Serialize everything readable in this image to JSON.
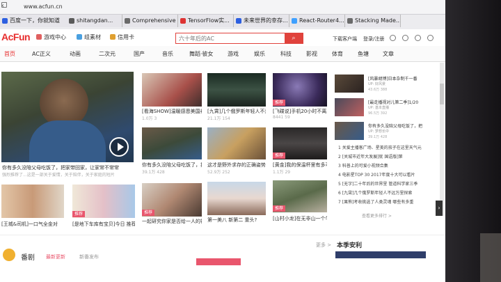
{
  "browser": {
    "url": "www.acfun.cn",
    "tabs": [
      {
        "label": "百度一下，你就知道",
        "color": "#2d5fe0"
      },
      {
        "label": "shitangdan...",
        "color": "#5a5a5a"
      },
      {
        "label": "Comprehensive",
        "color": "#6a6a6a"
      },
      {
        "label": "TensorFlow实...",
        "color": "#d33"
      },
      {
        "label": "未来世界的幸存...",
        "color": "#2d5fe0"
      },
      {
        "label": "React-Router4...",
        "color": "#3fa0ff"
      },
      {
        "label": "Stacking Made...",
        "color": "#6a6a6a"
      }
    ]
  },
  "header": {
    "logo": "AcFun",
    "links": [
      "游戏中心",
      "组素材",
      "信用卡"
    ],
    "search_placeholder": "六十年后的AC",
    "download_client": "下载客户端",
    "login": "登录/注册"
  },
  "categories": [
    "首页",
    "AC正义",
    "动画",
    "二次元",
    "国产",
    "音乐",
    "舞蹈·彼女",
    "游戏",
    "娱乐",
    "科技",
    "影视",
    "体育",
    "鱼塘",
    "文章"
  ],
  "feature": {
    "caption": "你有多久没陪父母吃饭了，把家带回家，让家常不常常",
    "caption2": "强烈推荐了...这是一部关于爱情，关于陪伴，关于家庭的短片"
  },
  "grid": [
    {
      "title": "[看海SHOW]温暖感恩美国养",
      "meta": "1.0万  3",
      "badge": ""
    },
    {
      "title": "[九霄]几个俄罗斯年轻人不远",
      "meta": "21.1万  154",
      "badge": ""
    },
    {
      "title": "[飞碟说]手机20小时不离身...",
      "meta": "8441  59",
      "badge": "推荐"
    },
    {
      "title": "你有多久没陪父母吃饭了，把",
      "meta": "39.1万  428",
      "badge": ""
    },
    {
      "title": "这才是野外求存的正确姿势，看",
      "meta": "52.9万  252",
      "badge": ""
    },
    {
      "title": "[黄金]我的保温杯里有多可",
      "meta": "1.1万  29",
      "badge": "推荐"
    },
    {
      "title": "[王城&司机]一口气全金对",
      "meta": "",
      "badge": ""
    },
    {
      "title": "[是地下车库有宝贝]今日 推荐",
      "meta": "",
      "badge": "推荐"
    },
    {
      "title": "一起研究你家是否给一人的符",
      "meta": "",
      "badge": "推荐"
    },
    {
      "title": "第一美八 新第二 重头?",
      "meta": "",
      "badge": ""
    },
    {
      "title": "[山村小龙]在无非山一个牛不",
      "meta": "",
      "badge": "推荐"
    }
  ],
  "ranking": [
    {
      "title": "[风暴胡博]日本杂制千一番",
      "up": "UP: 好风景",
      "stat": "43.6万  388"
    },
    {
      "title": "[最走播视对儿第二季]1/20",
      "up": "UP: 基本直播",
      "stat": "96.5万  392"
    },
    {
      "title": "你有多久没陪父母吃饭了，把",
      "up": "UP: 梦想长中",
      "stat": "39.1万  428"
    }
  ],
  "news": [
    "1 关爱主播客广场、星美的孩子在这里天气元",
    "2 [关城市近年大发展]就 国语版]第",
    "3 科普上的可爱小视频合集",
    "4 电影星TOP 30 2017年度十大可以看片",
    "5 [无字]二十年后的世界里 管道科学家三季",
    "6 [九霄]几个俄罗斯年轻人不远万里探索",
    "7 [果熊]考收挑选了人类灵魂 哪些有多重"
  ],
  "more_rank": "查看更多排行 >",
  "bottom": {
    "section_left": "番剧",
    "tab1": "最新更新",
    "tab2": "新番发布",
    "more": "更多 >",
    "section_right": "本季安利"
  }
}
